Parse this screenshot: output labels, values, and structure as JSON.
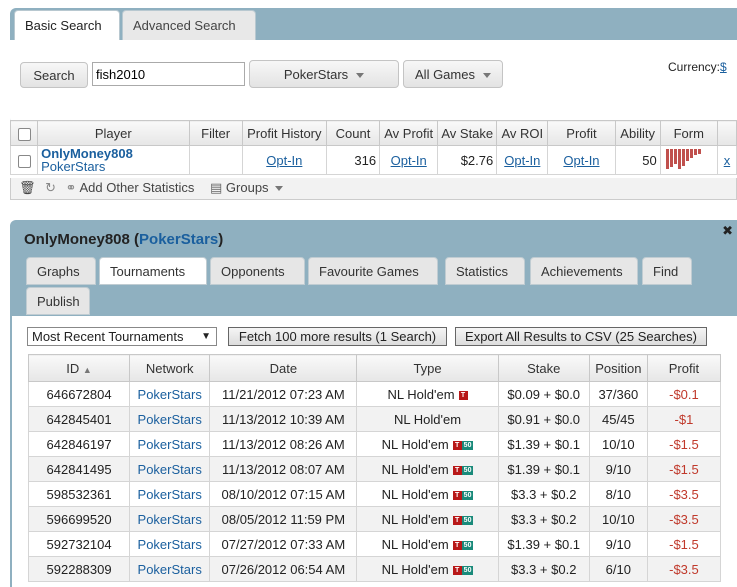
{
  "search_tabs": {
    "basic": "Basic Search",
    "advanced": "Advanced Search"
  },
  "search": {
    "button": "Search",
    "query": "fish2010",
    "network": "PokerStars",
    "games": "All Games",
    "currency_label": "Currency:",
    "currency_value": "$"
  },
  "results_table": {
    "headers": [
      "Player",
      "Filter",
      "Profit History",
      "Count",
      "Av Profit",
      "Av Stake",
      "Av ROI",
      "Profit",
      "Ability",
      "Form"
    ],
    "row": {
      "player": "OnlyMoney808",
      "network": "PokerStars",
      "profit_history": "Opt-In",
      "count": "316",
      "av_profit": "Opt-In",
      "av_stake": "$2.76",
      "av_roi": "Opt-In",
      "profit": "Opt-In",
      "ability": "50",
      "remove": "x"
    },
    "form_bars": [
      1.0,
      0.9,
      0.75,
      1.0,
      0.85,
      0.6,
      0.45,
      0.3,
      0.25
    ],
    "form_color": "#c0504d",
    "footer": {
      "add_stats": "Add Other Statistics",
      "groups": "Groups"
    }
  },
  "player_panel": {
    "player": "OnlyMoney808",
    "network": "PokerStars",
    "tabs": [
      "Graphs",
      "Tournaments",
      "Opponents",
      "Favourite Games",
      "Statistics",
      "Achievements",
      "Find",
      "Publish"
    ],
    "active_tab": "Tournaments",
    "filter_select": "Most Recent Tournaments",
    "fetch_button": "Fetch 100 more results (1 Search)",
    "export_button": "Export All Results to CSV (25 Searches)"
  },
  "tournaments": {
    "headers": [
      "ID",
      "Network",
      "Date",
      "Type",
      "Stake",
      "Position",
      "Profit"
    ],
    "rows": [
      {
        "id": "646672804",
        "network": "PokerStars",
        "date": "11/21/2012 07:23 AM",
        "type": "NL Hold'em",
        "badge_t": "T",
        "badge_n": "",
        "stake": "$0.09 + $0.0",
        "position": "37/360",
        "profit": "-$0.1"
      },
      {
        "id": "642845401",
        "network": "PokerStars",
        "date": "11/13/2012 10:39 AM",
        "type": "NL Hold'em",
        "badge_t": "",
        "badge_n": "",
        "stake": "$0.91 + $0.0",
        "position": "45/45",
        "profit": "-$1"
      },
      {
        "id": "642846197",
        "network": "PokerStars",
        "date": "11/13/2012 08:26 AM",
        "type": "NL Hold'em",
        "badge_t": "T",
        "badge_n": "50",
        "stake": "$1.39 + $0.1",
        "position": "10/10",
        "profit": "-$1.5"
      },
      {
        "id": "642841495",
        "network": "PokerStars",
        "date": "11/13/2012 08:07 AM",
        "type": "NL Hold'em",
        "badge_t": "T",
        "badge_n": "50",
        "stake": "$1.39 + $0.1",
        "position": "9/10",
        "profit": "-$1.5"
      },
      {
        "id": "598532361",
        "network": "PokerStars",
        "date": "08/10/2012 07:15 AM",
        "type": "NL Hold'em",
        "badge_t": "T",
        "badge_n": "50",
        "stake": "$3.3 + $0.2",
        "position": "8/10",
        "profit": "-$3.5"
      },
      {
        "id": "596699520",
        "network": "PokerStars",
        "date": "08/05/2012 11:59 PM",
        "type": "NL Hold'em",
        "badge_t": "T",
        "badge_n": "50",
        "stake": "$3.3 + $0.2",
        "position": "10/10",
        "profit": "-$3.5"
      },
      {
        "id": "592732104",
        "network": "PokerStars",
        "date": "07/27/2012 07:33 AM",
        "type": "NL Hold'em",
        "badge_t": "T",
        "badge_n": "50",
        "stake": "$1.39 + $0.1",
        "position": "9/10",
        "profit": "-$1.5"
      },
      {
        "id": "592288309",
        "network": "PokerStars",
        "date": "07/26/2012 06:54 AM",
        "type": "NL Hold'em",
        "badge_t": "T",
        "badge_n": "50",
        "stake": "$3.3 + $0.2",
        "position": "6/10",
        "profit": "-$3.5"
      }
    ]
  }
}
